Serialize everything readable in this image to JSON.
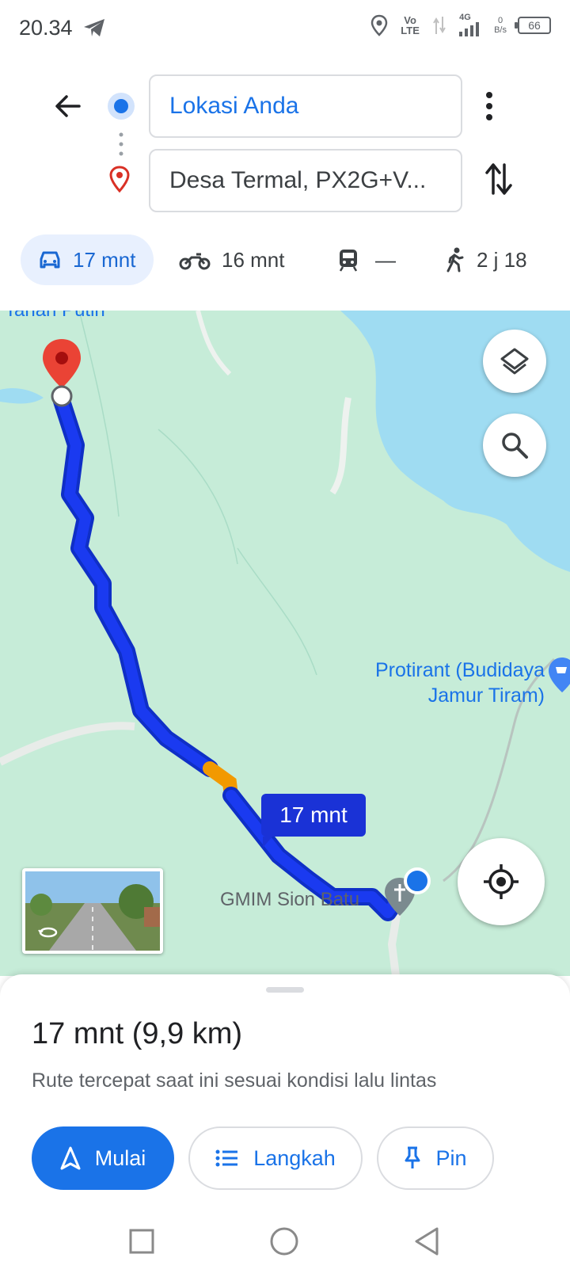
{
  "status_bar": {
    "time": "20.34",
    "network": "Vo LTE",
    "net_type": "4G",
    "data_rate_value": "0",
    "data_rate_unit": "B/s",
    "battery": "66"
  },
  "directions": {
    "origin": "Lokasi Anda",
    "destination": "Desa Termal, PX2G+V..."
  },
  "modes": [
    {
      "name": "car",
      "label": "17 mnt",
      "active": true
    },
    {
      "name": "motorcycle",
      "label": "16 mnt",
      "active": false
    },
    {
      "name": "transit",
      "label": "—",
      "active": false
    },
    {
      "name": "walk",
      "label": "2 j 18",
      "active": false
    }
  ],
  "map": {
    "place_top": "Tanah Putih",
    "place_shop_line1": "Protirant (Budidaya",
    "place_shop_line2": "Jamur Tiram)",
    "place_church": "GMIM Sion Batu",
    "route_chip": "17 mnt",
    "colors": {
      "route": "#1a3af0",
      "traffic": "#f29900",
      "water": "#9fdcf2",
      "land": "#c6ecd8"
    }
  },
  "summary": {
    "title": "17 mnt (9,9 km)",
    "subtitle": "Rute tercepat saat ini sesuai kondisi lalu lintas"
  },
  "actions": {
    "start": "Mulai",
    "steps": "Langkah",
    "pin": "Pin"
  }
}
